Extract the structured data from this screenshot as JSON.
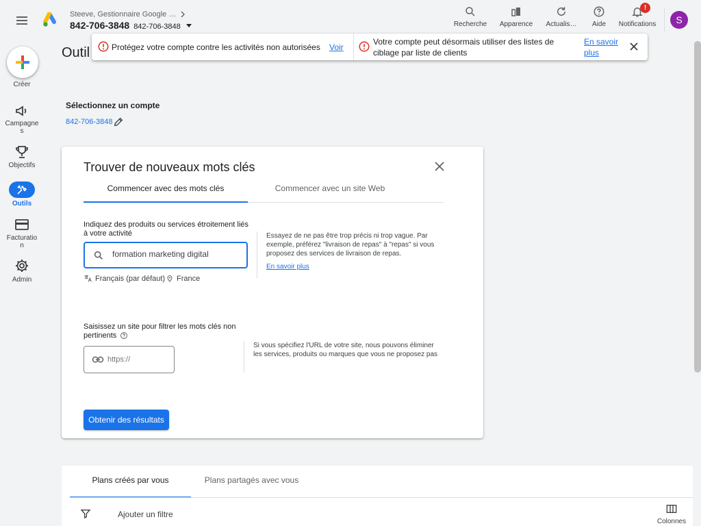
{
  "header": {
    "account_name": "Steeve, Gestionnaire Google …",
    "account_id": "842-706-3848",
    "account_id_sub": "842-706-3848",
    "actions": [
      {
        "label": "Recherche",
        "icon": "search-icon"
      },
      {
        "label": "Apparence",
        "icon": "appearance-icon"
      },
      {
        "label": "Actualis…",
        "icon": "refresh-icon"
      },
      {
        "label": "Aide",
        "icon": "help-icon"
      },
      {
        "label": "Notifications",
        "icon": "bell-icon"
      }
    ],
    "notification_badge": "!",
    "avatar_initial": "S",
    "avatar_color": "#8e24aa"
  },
  "sidebar": {
    "items": [
      {
        "label": "Créer",
        "icon": "plus-icon"
      },
      {
        "label": "Campagne\ns",
        "icon": "megaphone-icon"
      },
      {
        "label": "Objectifs",
        "icon": "trophy-icon"
      },
      {
        "label": "Outils",
        "icon": "tools-icon",
        "active": true
      },
      {
        "label": "Facturatio\nn",
        "icon": "credit-card-icon"
      },
      {
        "label": "Admin",
        "icon": "gear-icon"
      }
    ]
  },
  "page": {
    "title": "Outil d"
  },
  "banner": {
    "message_1": "Protégez votre compte contre les activités non autorisées",
    "link_1": "Voir",
    "message_2": "Votre compte peut désormais utiliser des listes de ciblage par liste de clients",
    "link_2": "En savoir plus"
  },
  "select_account": {
    "title": "Sélectionnez un compte",
    "account": "842-706-3848"
  },
  "keyword_card": {
    "title": "Trouver de nouveaux mots clés",
    "tabs": [
      {
        "label": "Commencer avec des mots clés",
        "active": true
      },
      {
        "label": "Commencer avec un site Web",
        "active": false
      }
    ],
    "products_label": "Indiquez des produits ou services étroitement liés à votre activité",
    "keyword_value": "formation marketing digital",
    "language": "Français (par défaut)",
    "location": "France",
    "help_text": "Essayez de ne pas être trop précis ni trop vague. Par exemple, préférez \"livraison de repas\" à \"repas\" si vous proposez des services de livraison de repas.",
    "help_link": "En savoir plus",
    "site_label": "Saisissez un site pour filtrer les mots clés non pertinents",
    "url_placeholder": "https://",
    "site_help_text": "Si vous spécifiez l'URL de votre site, nous pouvons éliminer les services, produits ou marques que vous ne proposez pas",
    "submit_label": "Obtenir des résultats"
  },
  "plans": {
    "tabs": [
      {
        "label": "Plans créés par vous",
        "active": true
      },
      {
        "label": "Plans partagés avec vous",
        "active": false
      }
    ],
    "filter_label": "Ajouter un filtre",
    "columns_label": "Colonnes"
  },
  "colors": {
    "accent": "#1a73e8",
    "error": "#d93025",
    "background": "#f1f3f4"
  }
}
